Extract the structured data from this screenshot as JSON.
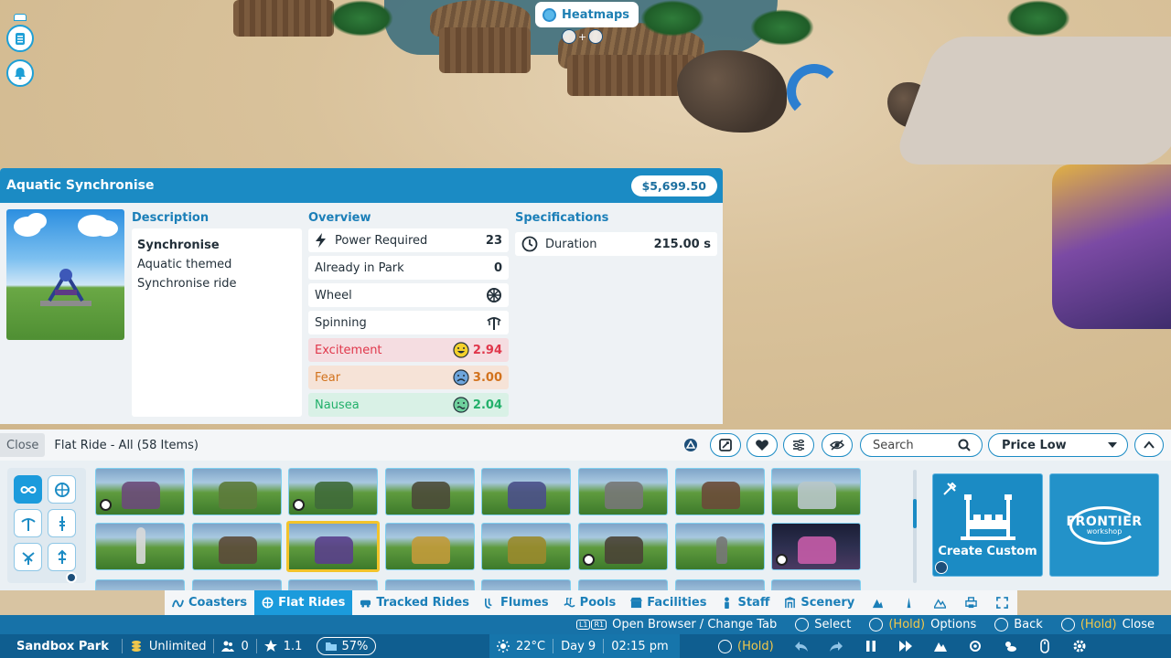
{
  "heatmaps": {
    "label": "Heatmaps"
  },
  "ride": {
    "title": "Aquatic Synchronise",
    "price": "$5,699.50",
    "description_label": "Description",
    "description": [
      "Synchronise",
      "Aquatic themed",
      "Synchronise ride"
    ],
    "overview_label": "Overview",
    "overview": [
      {
        "label": "Power Required",
        "value": "23",
        "icon": "lightning-icon"
      },
      {
        "label": "Already in Park",
        "value": "0"
      },
      {
        "label": "Wheel",
        "icon": "wheel-icon"
      },
      {
        "label": "Spinning",
        "icon": "spinning-icon"
      },
      {
        "label": "Excitement",
        "value": "2.94",
        "icon": "happy-face-icon",
        "color": "#e0374b"
      },
      {
        "label": "Fear",
        "value": "3.00",
        "icon": "scared-face-icon",
        "color": "#d2721d"
      },
      {
        "label": "Nausea",
        "value": "2.04",
        "icon": "sick-face-icon",
        "color": "#22b06a"
      }
    ],
    "specifications_label": "Specifications",
    "specifications": [
      {
        "label": "Duration",
        "value": "215.00 s",
        "icon": "clock-icon"
      }
    ]
  },
  "browser": {
    "close_label": "Close",
    "title": "Flat Ride - All (58 Items)",
    "search_placeholder": "Search",
    "sort_value": "Price Low",
    "create_custom_label": "Create Custom",
    "frontier_name": "FRONTIER",
    "frontier_sub": "workshop"
  },
  "categories": [
    {
      "label": "Coasters",
      "icon": "coaster-icon"
    },
    {
      "label": "Flat Rides",
      "icon": "flat-ride-icon",
      "active": true
    },
    {
      "label": "Tracked Rides",
      "icon": "tracked-ride-icon"
    },
    {
      "label": "Flumes",
      "icon": "flume-icon"
    },
    {
      "label": "Pools",
      "icon": "pool-icon"
    },
    {
      "label": "Facilities",
      "icon": "facilities-icon"
    },
    {
      "label": "Staff",
      "icon": "staff-icon"
    },
    {
      "label": "Scenery",
      "icon": "scenery-icon"
    }
  ],
  "hints": {
    "open_browser": "Open Browser / Change Tab",
    "select": "Select",
    "hold": "(Hold)",
    "options": "Options",
    "back": "Back",
    "close": "Close"
  },
  "status": {
    "park_name": "Sandbox Park",
    "money": "Unlimited",
    "guests": "0",
    "rating": "1.1",
    "approval": "57%",
    "temperature": "22°C",
    "day": "Day 9",
    "time": "02:15 pm",
    "hold": "(Hold)"
  },
  "colors": {
    "accent": "#1b8bc4",
    "excitement": "#e0374b",
    "fear": "#d2721d",
    "nausea": "#22b06a",
    "selected_tile": "#f3c42a"
  }
}
